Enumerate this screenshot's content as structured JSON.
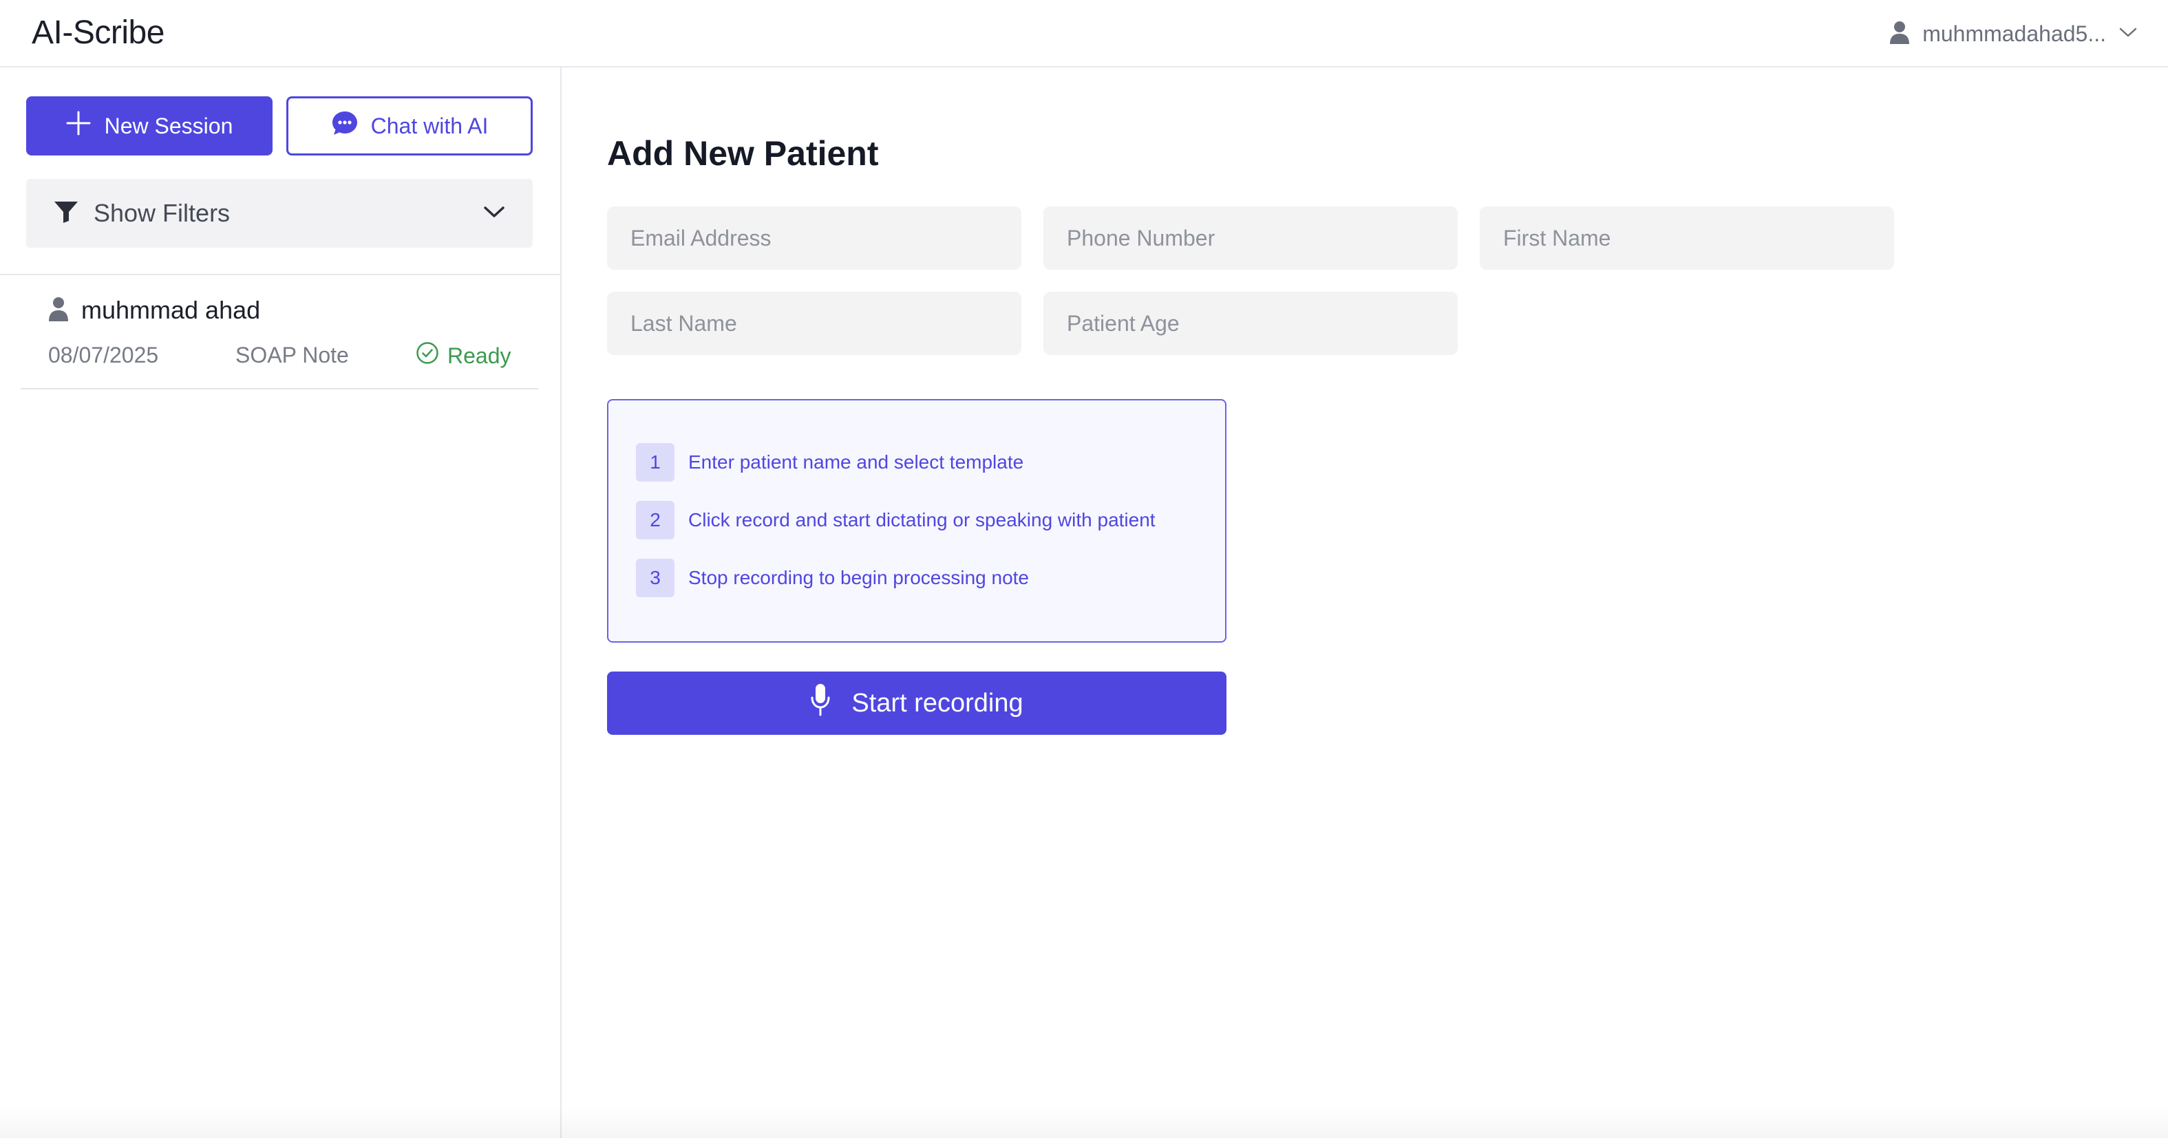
{
  "header": {
    "app_title": "AI-Scribe",
    "user_name": "muhmmadahad5..."
  },
  "sidebar": {
    "new_session_label": "New Session",
    "chat_label": "Chat with AI",
    "filters_label": "Show Filters",
    "sessions": [
      {
        "patient_name": "muhmmad ahad",
        "date": "08/07/2025",
        "note_type": "SOAP Note",
        "status": "Ready"
      }
    ]
  },
  "main": {
    "title": "Add New Patient",
    "fields": {
      "email_placeholder": "Email Address",
      "phone_placeholder": "Phone Number",
      "first_name_placeholder": "First Name",
      "last_name_placeholder": "Last Name",
      "age_placeholder": "Patient Age"
    },
    "steps": [
      {
        "number": "1",
        "text": "Enter patient name and select template"
      },
      {
        "number": "2",
        "text": "Click record and start dictating or speaking with patient"
      },
      {
        "number": "3",
        "text": "Stop recording to begin processing note"
      }
    ],
    "record_label": "Start recording"
  },
  "colors": {
    "accent": "#4f46e0",
    "status_ready": "#3c9a4e",
    "field_bg": "#f3f3f4"
  },
  "icons": [
    "user-icon",
    "chevron-down-icon",
    "plus-icon",
    "chat-bubble-icon",
    "filter-icon",
    "check-circle-icon",
    "microphone-icon"
  ]
}
